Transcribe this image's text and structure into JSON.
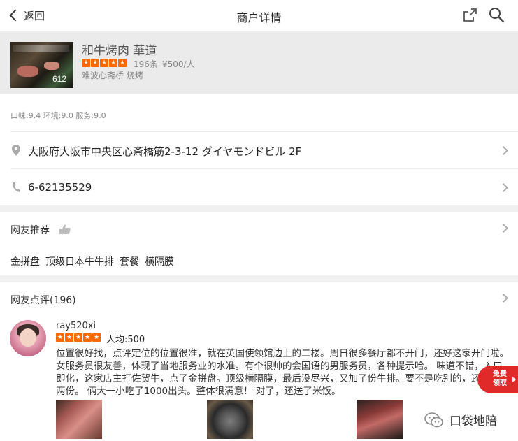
{
  "header": {
    "back_label": "返回",
    "title": "商户详情"
  },
  "shop": {
    "name": "和牛烤肉 華道",
    "photo_count": "612",
    "rating_stars": 5,
    "review_count": "196条",
    "avg_price": "¥500/人",
    "area_category": "难波心斋桥 烧烤"
  },
  "scores": "口味:9.4 环境:9.0 服务:9.0",
  "address": "大阪府大阪市中央区心斎橋筋2-3-12 ダイヤモンドビル 2F",
  "phone": "6-62135529",
  "recommend": {
    "title": "网友推荐",
    "tags": [
      "金拼盘",
      "顶级日本牛牛排",
      "套餐",
      "横隔膜"
    ]
  },
  "reviews": {
    "title": "网友点评(196)",
    "items": [
      {
        "username": "ray520xi",
        "stars": 5,
        "avg_price": "人均:500",
        "text": "位置很好找，点评定位的位置很准，就在英国使领馆边上的二楼。周日很多餐厅都不开门，还好这家开门啦。女服务员很友善，体现了当地服务业的水准。有个很帅的会国语的男服务员，各种提示哈。 味道不错，入口即化，这家店主打佐贺牛，点了金拼盘。顶级横隔膜，最后没尽兴，又加了份牛排。要不是吃别的，还可以吃两份。 俩大一小吃了1000出头。整体很满意！ 对了，还送了米饭。"
      }
    ]
  },
  "coupon": {
    "line1": "免费",
    "line2": "领取"
  },
  "watermark": "口袋地陪",
  "colors": {
    "star": "#ff6a00",
    "coupon": "#e02a2a",
    "bg": "#f0f0f0"
  }
}
